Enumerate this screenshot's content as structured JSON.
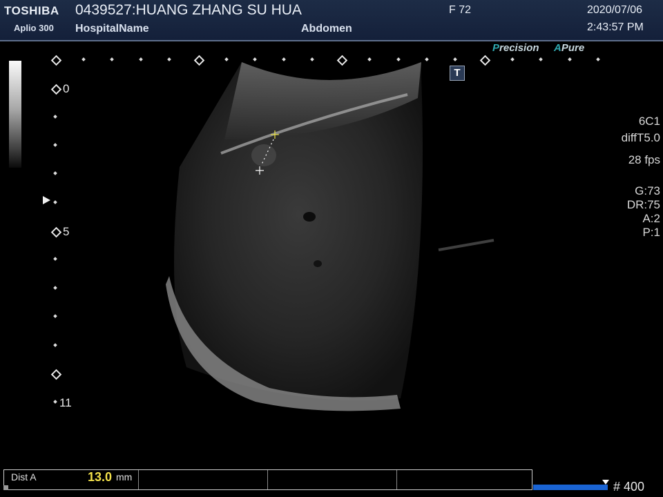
{
  "header": {
    "brand": "TOSHIBA",
    "model": "Aplio 300",
    "patient": "0439527:HUANG ZHANG SU HUA",
    "hospital": "HospitalName",
    "study": "Abdomen",
    "frame": "F  72",
    "date": "2020/07/06",
    "time": "2:43:57 PM"
  },
  "badges": {
    "precision_a": "P",
    "precision_b": "recision",
    "apure_a": "A",
    "apure_b": "Pure",
    "tbutton": "T"
  },
  "depth_scale": {
    "top": "0",
    "mid": "5",
    "bottom": "11"
  },
  "params": {
    "probe": "6C1",
    "mode": "diffT5.0",
    "fps": "28 fps",
    "gain": "G:73",
    "dr": "DR:75",
    "a": "A:2",
    "p": "P:1"
  },
  "measurement": {
    "label": "Dist A",
    "value": "13.0",
    "unit": "mm"
  },
  "footer": {
    "frame_count": "# 400"
  },
  "colors": {
    "header_bg": "#14203a",
    "accent_teal": "#2fa9b0",
    "measurement_value": "#f2e04a",
    "progress_bar": "#1a64d4"
  }
}
